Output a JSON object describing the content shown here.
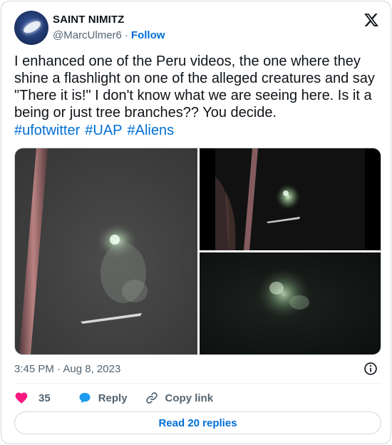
{
  "author": {
    "name": "SAINT NIMITZ",
    "handle": "@MarcUlmer6",
    "separator": "·",
    "follow_label": "Follow"
  },
  "tweet": {
    "text": "I enhanced one of the Peru videos, the one where they shine a flashlight on one of the alleged creatures and say \"There it is!\" I don't know what we are seeing here. Is it a being or just tree branches?? You decide.",
    "hashtags": [
      "#ufotwitter",
      "#UAP",
      "#Aliens"
    ]
  },
  "media": {
    "count": 3,
    "descriptions": [],
    "icons": [
      "flashlight-frame",
      "creature-frame",
      "blurred-frame"
    ]
  },
  "meta": {
    "time": "3:45 PM",
    "separator": "·",
    "date": "Aug 8, 2023"
  },
  "actions": {
    "like_count": "35",
    "reply_label": "Reply",
    "copy_link_label": "Copy link"
  },
  "read_replies_label": "Read 20 replies",
  "colors": {
    "link": "#006fd6",
    "heart": "#f91880",
    "reply_bubble": "#1d9bf0",
    "secondary_text": "#536471",
    "border": "#cfd9de"
  }
}
